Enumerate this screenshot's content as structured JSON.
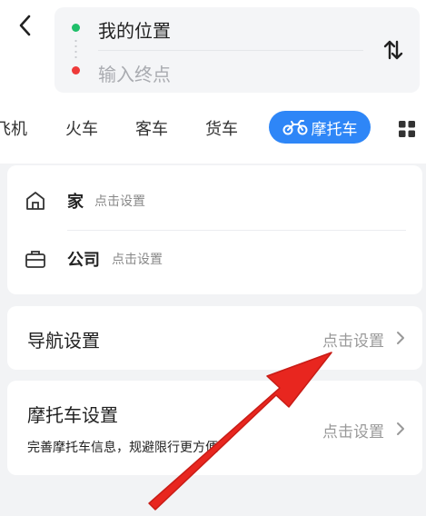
{
  "route": {
    "origin": "我的位置",
    "destination_placeholder": "输入终点"
  },
  "tabs": [
    {
      "label": "飞机",
      "visible_text": "机"
    },
    {
      "label": "火车"
    },
    {
      "label": "客车"
    },
    {
      "label": "货车"
    },
    {
      "label": "摩托车",
      "active": true
    }
  ],
  "places": {
    "home": {
      "name": "家",
      "hint": "点击设置"
    },
    "company": {
      "name": "公司",
      "hint": "点击设置"
    }
  },
  "nav_settings": {
    "title": "导航设置",
    "action": "点击设置"
  },
  "moto_settings": {
    "title": "摩托车设置",
    "subtitle": "完善摩托车信息，规避限行更方便",
    "action": "点击设置"
  },
  "colors": {
    "accent": "#2e86f7",
    "origin_dot": "#1fbf6a",
    "destination_dot": "#ee3a3a",
    "annotation_arrow": "#e8261f"
  },
  "icons": [
    "back-arrow-icon",
    "swap-icon",
    "motorcycle-icon",
    "grid-icon",
    "home-icon",
    "briefcase-icon",
    "chevron-right-icon"
  ]
}
